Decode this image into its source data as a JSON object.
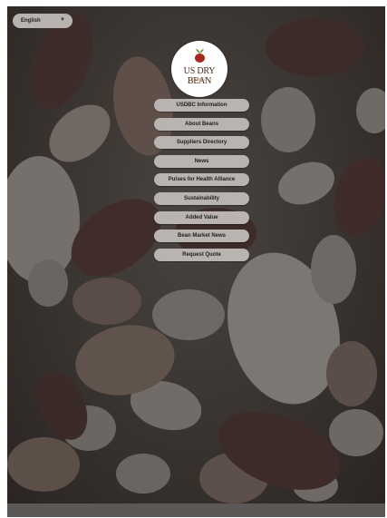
{
  "language": {
    "selected": "English"
  },
  "logo": {
    "brand": "US DRY BEAN",
    "subtitle": "Council"
  },
  "menu": {
    "items": [
      {
        "label": "USDBC Information"
      },
      {
        "label": "About Beans"
      },
      {
        "label": "Suppliers Directory"
      },
      {
        "label": "News"
      },
      {
        "label": "Pulses for Health Alliance"
      },
      {
        "label": "Sustainability"
      },
      {
        "label": "Added Value"
      },
      {
        "label": "Bean Market News"
      },
      {
        "label": "Request Quote"
      }
    ]
  },
  "colors": {
    "background": "#3a3633",
    "button": "#b9b4af",
    "footer": "#5b5856"
  }
}
